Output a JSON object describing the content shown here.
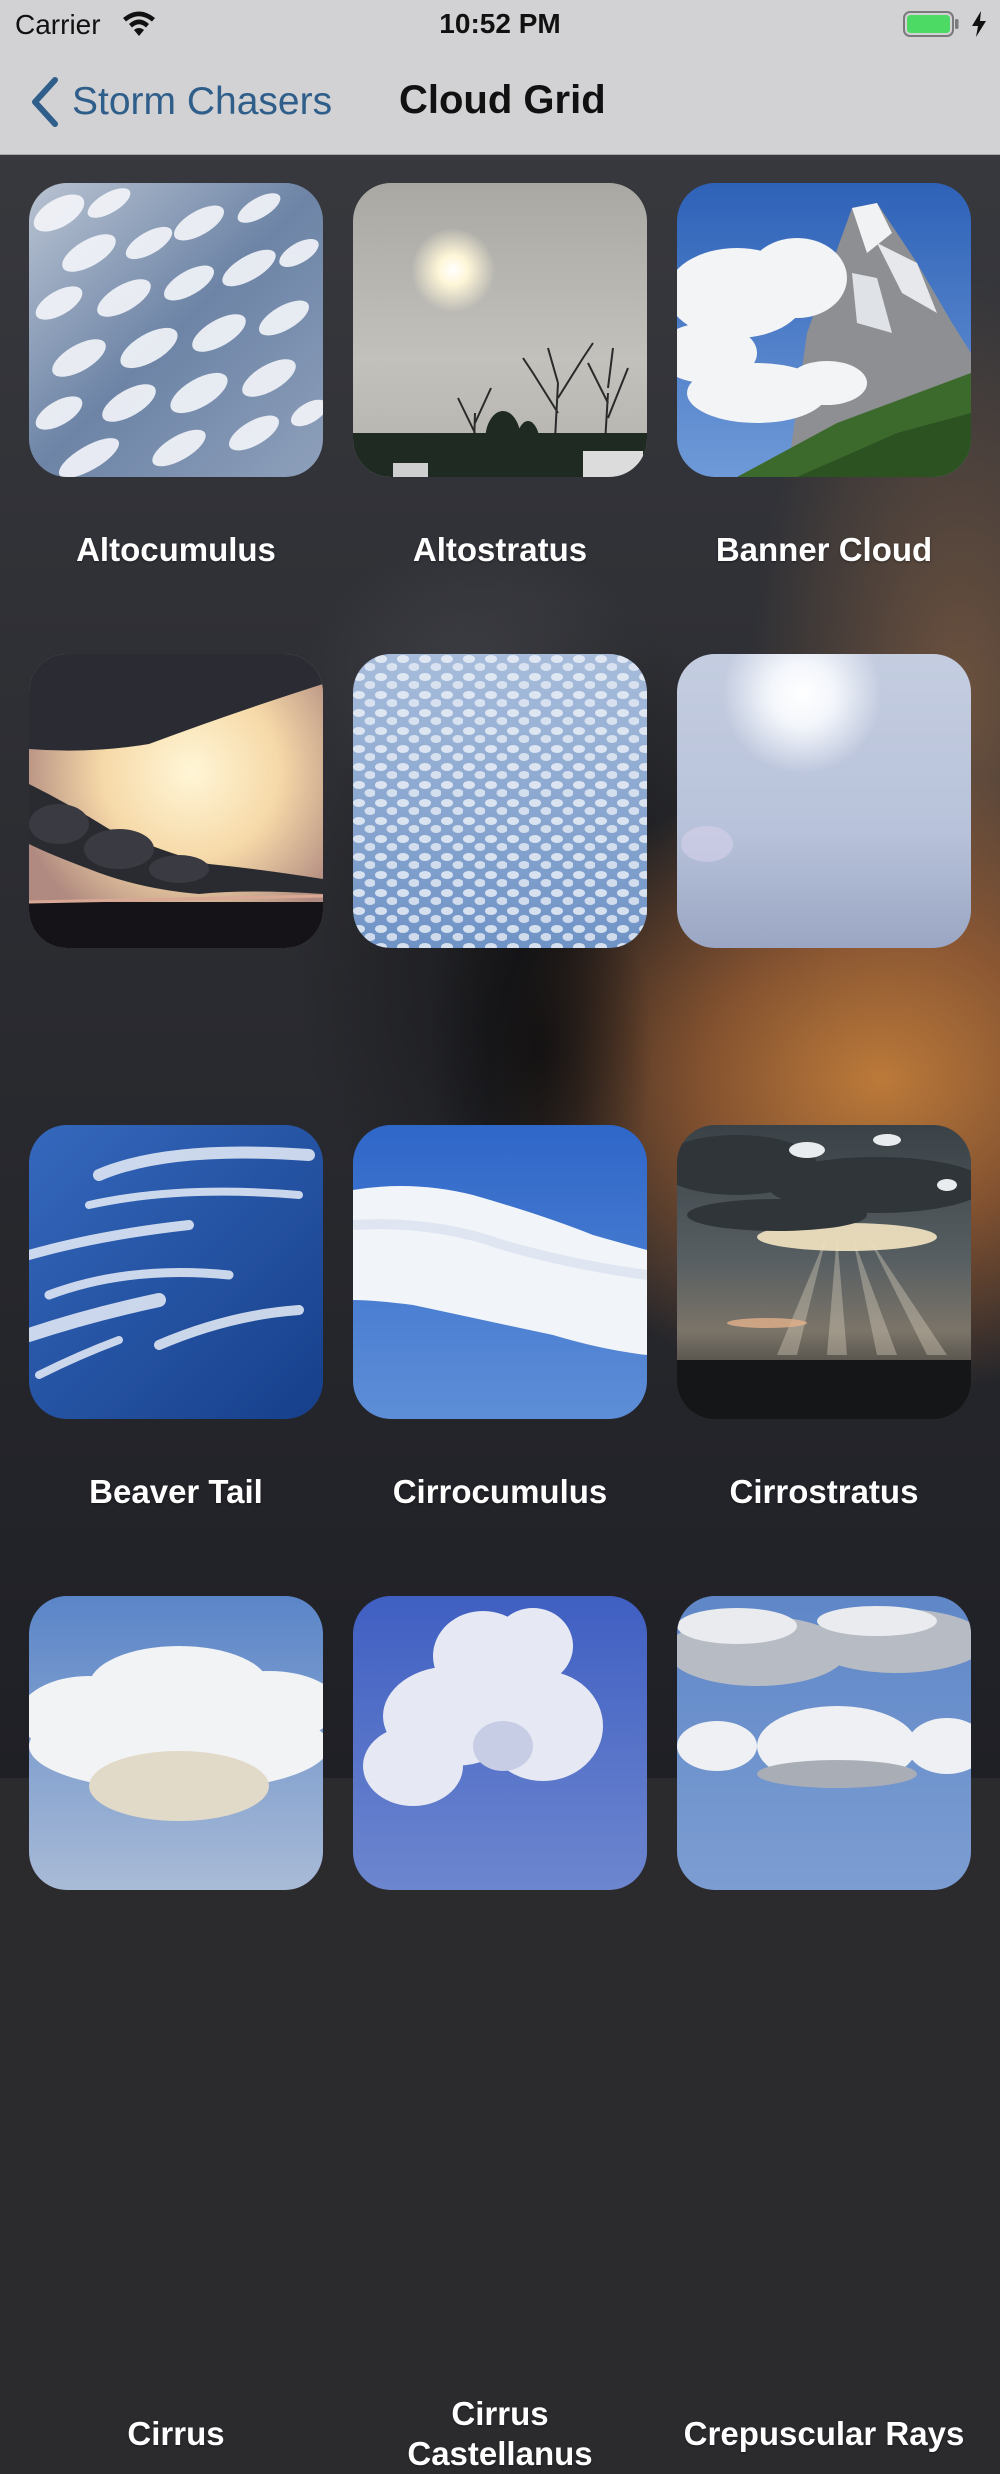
{
  "status_bar": {
    "carrier": "Carrier",
    "time": "10:52 PM",
    "icons": [
      "wifi-icon",
      "battery-icon",
      "charging-bolt-icon"
    ],
    "battery_color": "#4cd964"
  },
  "nav": {
    "back_label": "Storm Chasers",
    "title": "Cloud Grid",
    "back_color": "#2f5e8b"
  },
  "clouds": [
    {
      "name": "Altocumulus"
    },
    {
      "name": "Altostratus"
    },
    {
      "name": "Banner Cloud"
    },
    {
      "name": "Beaver Tail"
    },
    {
      "name": "Cirrocumulus"
    },
    {
      "name": "Cirrostratus"
    },
    {
      "name": "Cirrus"
    },
    {
      "name": "Cirrus\nCastellanus"
    },
    {
      "name": "Crepuscular Rays"
    },
    {
      "name": ""
    },
    {
      "name": ""
    },
    {
      "name": ""
    }
  ]
}
